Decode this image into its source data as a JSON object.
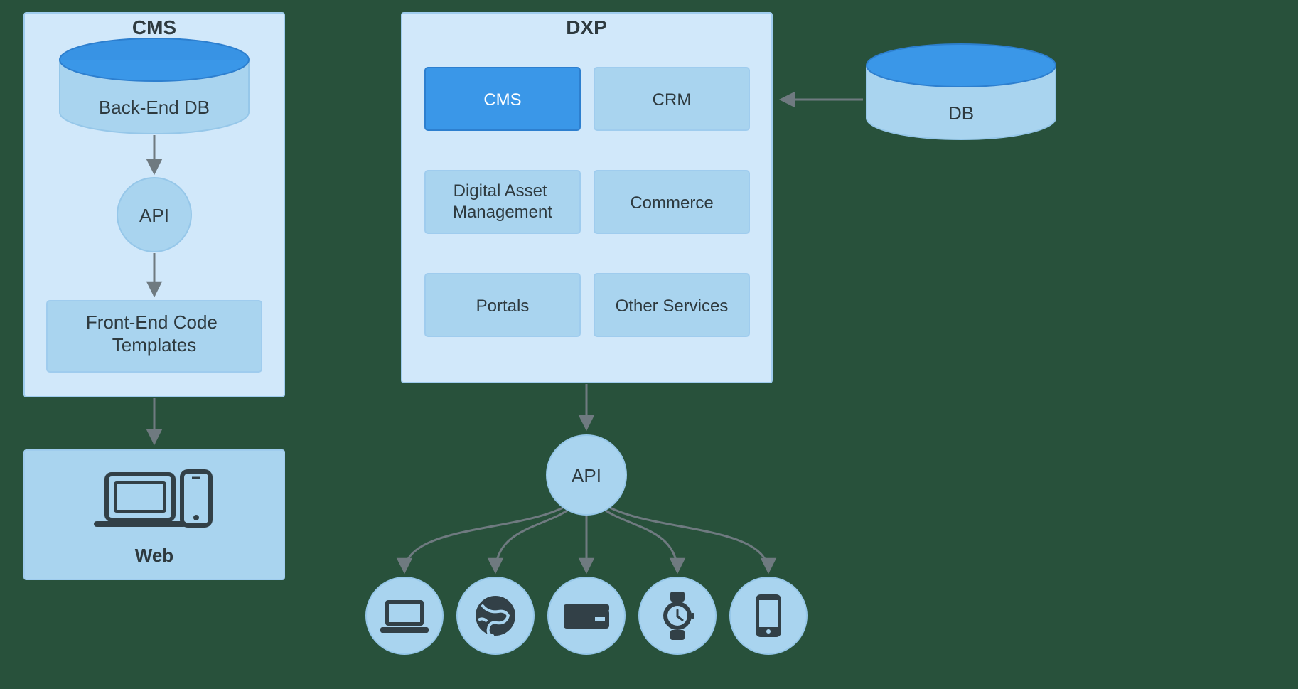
{
  "colors": {
    "panel_fill": "#d1e8fa",
    "panel_stroke": "#9fccee",
    "card_fill": "#a9d4ef",
    "card_stroke": "#9fccee",
    "accent_fill": "#3a97e8",
    "accent_stroke": "#2d7fcf",
    "bubble_fill": "#a9d4ef",
    "bubble_stroke": "#96c7e9",
    "db_top": "#3a97e8",
    "db_side": "#a9d4ef",
    "db_stroke": "#96c7e9",
    "arrow": "#6f7a80",
    "icon": "#324047",
    "text": "#2e3a3f",
    "white": "#ffffff"
  },
  "cms": {
    "title": "CMS",
    "db_label": "Back-End  DB",
    "api_label": "API",
    "template_label": "Front-End  Code\nTemplates",
    "web_label": "Web"
  },
  "dxp": {
    "title": "DXP",
    "api_label": "API",
    "db_label": "DB",
    "cards": [
      {
        "label": "CMS",
        "accent": true
      },
      {
        "label": "CRM",
        "accent": false
      },
      {
        "label": "Digital Asset\nManagement",
        "accent": false
      },
      {
        "label": "Commerce",
        "accent": false
      },
      {
        "label": "Portals",
        "accent": false
      },
      {
        "label": "Other Services",
        "accent": false
      }
    ],
    "channels": [
      "laptop",
      "globe",
      "set-top",
      "watch",
      "phone"
    ]
  }
}
